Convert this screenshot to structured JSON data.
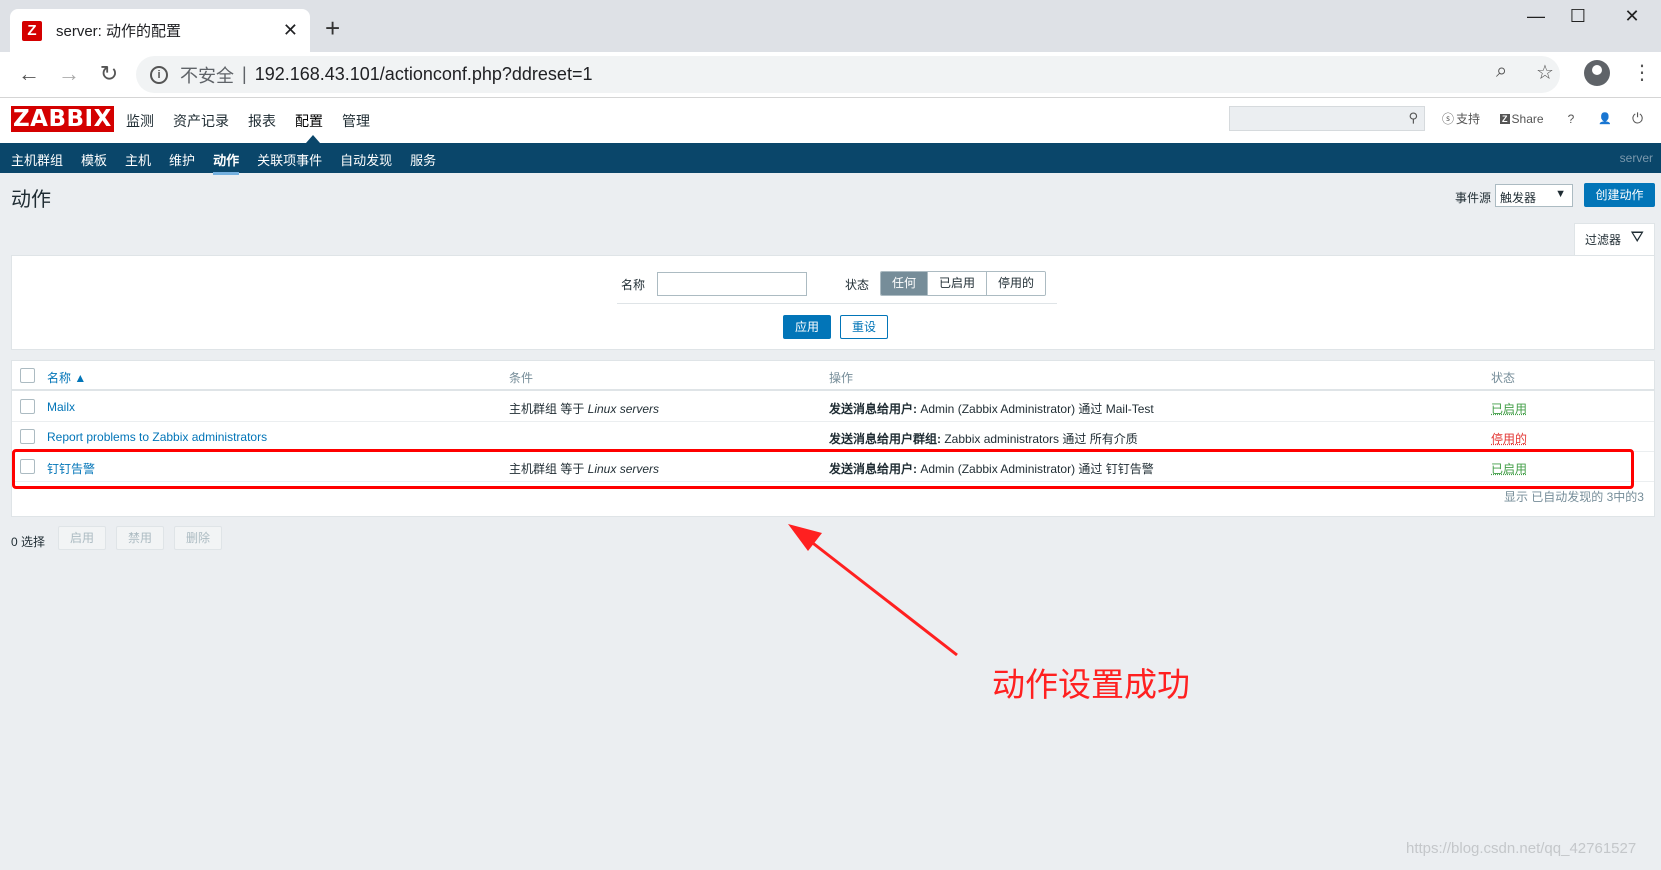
{
  "browser": {
    "tab_title": "server: 动作的配置",
    "favicon": "Z",
    "close": "✕",
    "new_tab": "+",
    "minimize": "—",
    "maximize": "☐",
    "close_window": "✕",
    "back": "←",
    "forward": "→",
    "reload": "↻",
    "info": "i",
    "insecure_label": "不安全",
    "separator": "|",
    "url": "192.168.43.101/actionconf.php?ddreset=1",
    "zoom_icon": "⌕",
    "star_icon": "☆",
    "menu_icon": "⋮"
  },
  "header": {
    "logo": "ZABBIX",
    "main_menu": [
      "监测",
      "资产记录",
      "报表",
      "配置",
      "管理"
    ],
    "search_icon": "⚲",
    "support": "支持",
    "support_icon": "ⓢ",
    "share": "Share",
    "share_icon": "Z",
    "help": "?",
    "user_icon": "👤",
    "logout_icon": "⏻"
  },
  "sub_menu": {
    "items": [
      "主机群组",
      "模板",
      "主机",
      "维护",
      "动作",
      "关联项事件",
      "自动发现",
      "服务"
    ],
    "server": "server"
  },
  "page": {
    "title": "动作",
    "event_source_label": "事件源",
    "event_source_value": "触发器",
    "create_button": "创建动作"
  },
  "filter": {
    "tab_label": "过滤器",
    "name_label": "名称",
    "name_value": "",
    "status_label": "状态",
    "status_options": [
      "任何",
      "已启用",
      "停用的"
    ],
    "status_selected": "任何",
    "apply": "应用",
    "reset": "重设"
  },
  "table": {
    "columns": {
      "name": "名称 ▲",
      "conditions": "条件",
      "operations": "操作",
      "status": "状态"
    },
    "rows": [
      {
        "name": "Mailx",
        "cond_prefix": "主机群组 等于 ",
        "cond_value": "Linux servers",
        "op_bold": "发送消息给用户: ",
        "op_rest": "Admin (Zabbix Administrator) 通过 Mail-Test",
        "status": "已启用"
      },
      {
        "name": "Report problems to Zabbix administrators",
        "cond_prefix": "",
        "cond_value": "",
        "op_bold": "发送消息给用户群组: ",
        "op_rest": "Zabbix administrators 通过 所有介质",
        "status": "停用的"
      },
      {
        "name": "钉钉告警",
        "cond_prefix": "主机群组 等于 ",
        "cond_value": "Linux servers",
        "op_bold": "发送消息给用户: ",
        "op_rest": "Admin (Zabbix Administrator) 通过 钉钉告警",
        "status": "已启用"
      }
    ],
    "footer": "显示 已自动发现的 3中的3"
  },
  "mass": {
    "selected": "0 选择",
    "enable": "启用",
    "disable": "禁用",
    "delete": "删除"
  },
  "annotation": {
    "text": "动作设置成功",
    "color": "#ff2020"
  },
  "watermark": "https://blog.csdn.net/qq_42761527"
}
